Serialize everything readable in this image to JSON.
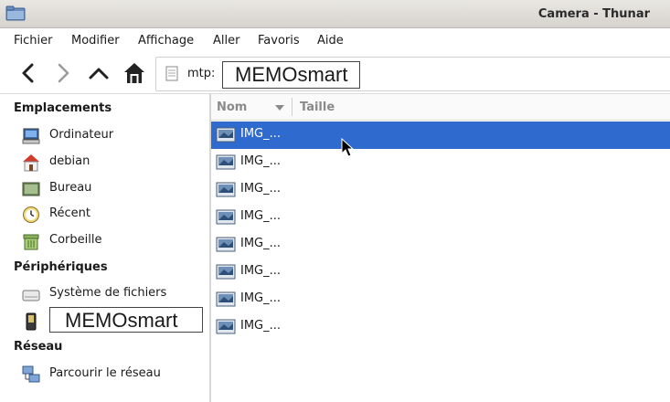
{
  "window": {
    "title": "Camera - Thunar"
  },
  "menu": [
    "Fichier",
    "Modifier",
    "Affichage",
    "Aller",
    "Favoris",
    "Aide"
  ],
  "location": {
    "prefix": "mtp:",
    "device": "MEMOsmart"
  },
  "sidebar": {
    "places_header": "Emplacements",
    "places": [
      {
        "label": "Ordinateur",
        "icon": "computer-icon"
      },
      {
        "label": "debian",
        "icon": "home-icon"
      },
      {
        "label": "Bureau",
        "icon": "desktop-icon"
      },
      {
        "label": "Récent",
        "icon": "recent-icon"
      },
      {
        "label": "Corbeille",
        "icon": "trash-icon"
      }
    ],
    "devices_header": "Périphériques",
    "devices": [
      {
        "label": "Système de fichiers",
        "icon": "drive-icon"
      },
      {
        "label": "MEMOsmart",
        "icon": "phone-icon"
      }
    ],
    "network_header": "Réseau",
    "network": [
      {
        "label": "Parcourir le réseau",
        "icon": "network-icon"
      }
    ]
  },
  "columns": {
    "name": "Nom",
    "size": "Taille"
  },
  "files": [
    {
      "name": "IMG_...",
      "selected": true
    },
    {
      "name": "IMG_...",
      "selected": false
    },
    {
      "name": "IMG_...",
      "selected": false
    },
    {
      "name": "IMG_...",
      "selected": false
    },
    {
      "name": "IMG_...",
      "selected": false
    },
    {
      "name": "IMG_...",
      "selected": false
    },
    {
      "name": "IMG_...",
      "selected": false
    },
    {
      "name": "IMG_...",
      "selected": false
    }
  ],
  "colors": {
    "selection": "#2f6bcf"
  }
}
